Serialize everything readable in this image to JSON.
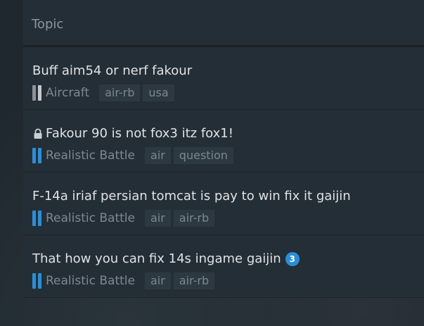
{
  "header": {
    "topic_label": "Topic"
  },
  "colors": {
    "aircraft_bar_left": "#8d9399",
    "aircraft_bar_right": "#c5c9cc",
    "realistic_bar": "#2a8fd6",
    "badge": "#2a8fd6"
  },
  "topics": [
    {
      "title": "Buff aim54 or nerf fakour",
      "locked": false,
      "category": "Aircraft",
      "tags": [
        "air-rb",
        "usa"
      ],
      "reply_badge": ""
    },
    {
      "title": "Fakour 90 is not fox3 itz fox1!",
      "locked": true,
      "category": "Realistic Battle",
      "tags": [
        "air",
        "question"
      ],
      "reply_badge": ""
    },
    {
      "title": "F-14a iriaf persian tomcat is pay to win fix it gaijin",
      "locked": false,
      "category": "Realistic Battle",
      "tags": [
        "air",
        "air-rb"
      ],
      "reply_badge": ""
    },
    {
      "title": "That how you can fix 14s ingame gaijin",
      "locked": false,
      "category": "Realistic Battle",
      "tags": [
        "air",
        "air-rb"
      ],
      "reply_badge": "3"
    }
  ]
}
